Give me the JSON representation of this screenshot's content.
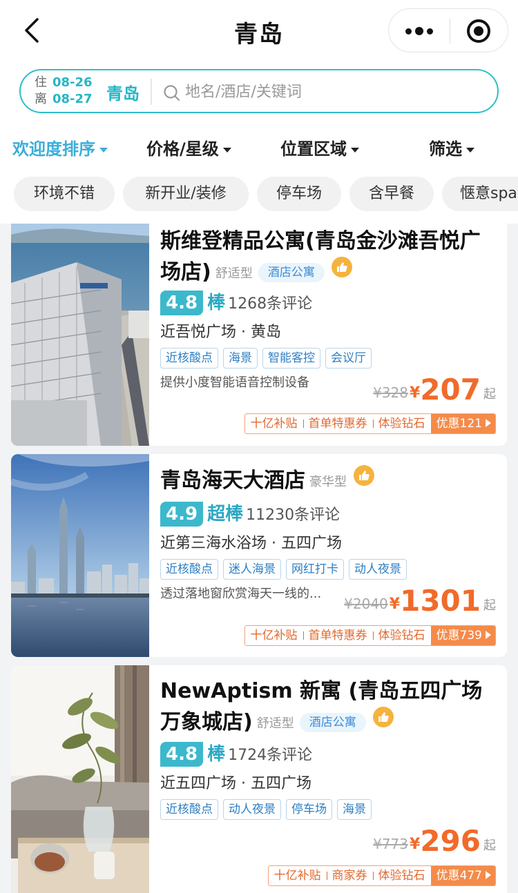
{
  "nav": {
    "title": "青岛",
    "back_icon": "chevron-left-icon",
    "more_icon": "more-dots-icon",
    "close_icon": "target-circle-icon"
  },
  "search": {
    "checkin_label": "住",
    "checkin": "08-26",
    "checkout_label": "离",
    "checkout": "08-27",
    "city": "青岛",
    "placeholder": "地名/酒店/关键词",
    "accent_color": "#2cbfca"
  },
  "sorts": [
    {
      "label": "欢迎度排序",
      "active": true
    },
    {
      "label": "价格/星级",
      "active": false
    },
    {
      "label": "位置区域",
      "active": false
    },
    {
      "label": "筛选",
      "active": false
    }
  ],
  "chips": [
    "环境不错",
    "新开业/装修",
    "停车场",
    "含早餐",
    "惬意spa"
  ],
  "hotels": [
    {
      "name": "斯维登精品公寓(青岛金沙滩吾悦广场店)",
      "grade": "舒适型",
      "type_badge": "酒店公寓",
      "score": "4.8",
      "score_level": "棒",
      "reviews": "1268条评论",
      "location": "近吾悦广场 · 黄岛",
      "tags": [
        "近核酸点",
        "海景",
        "智能客控",
        "会议厅"
      ],
      "description": "提供小度智能语音控制设备",
      "original_price": "¥328",
      "currency": "¥",
      "price": "207",
      "price_suffix": "起",
      "promos": [
        "十亿补贴",
        "首单特惠券",
        "体验钻石"
      ],
      "discount": "优惠121"
    },
    {
      "name": "青岛海天大酒店",
      "grade": "豪华型",
      "score": "4.9",
      "score_level": "超棒",
      "reviews": "11230条评论",
      "location": "近第三海水浴场 · 五四广场",
      "tags": [
        "近核酸点",
        "迷人海景",
        "网红打卡",
        "动人夜景"
      ],
      "description": "透过落地窗欣赏海天一线的...",
      "original_price": "¥2040",
      "currency": "¥",
      "price": "1301",
      "price_suffix": "起",
      "promos": [
        "十亿补贴",
        "首单特惠券",
        "体验钻石"
      ],
      "discount": "优惠739"
    },
    {
      "name": "NewAptism 新寓 (青岛五四广场万象城店)",
      "grade": "舒适型",
      "type_badge": "酒店公寓",
      "score": "4.8",
      "score_level": "棒",
      "reviews": "1724条评论",
      "location": "近五四广场 · 五四广场",
      "tags": [
        "近核酸点",
        "动人夜景",
        "停车场",
        "海景"
      ],
      "original_price": "¥773",
      "currency": "¥",
      "price": "296",
      "price_suffix": "起",
      "promos": [
        "十亿补贴",
        "商家券",
        "体验钻石"
      ],
      "discount": "优惠477"
    }
  ],
  "colors": {
    "price": "#f16a2a",
    "score_bg": "#3cb8cc",
    "active_sort": "#3aaed8",
    "thumb": "#f5b33d"
  }
}
